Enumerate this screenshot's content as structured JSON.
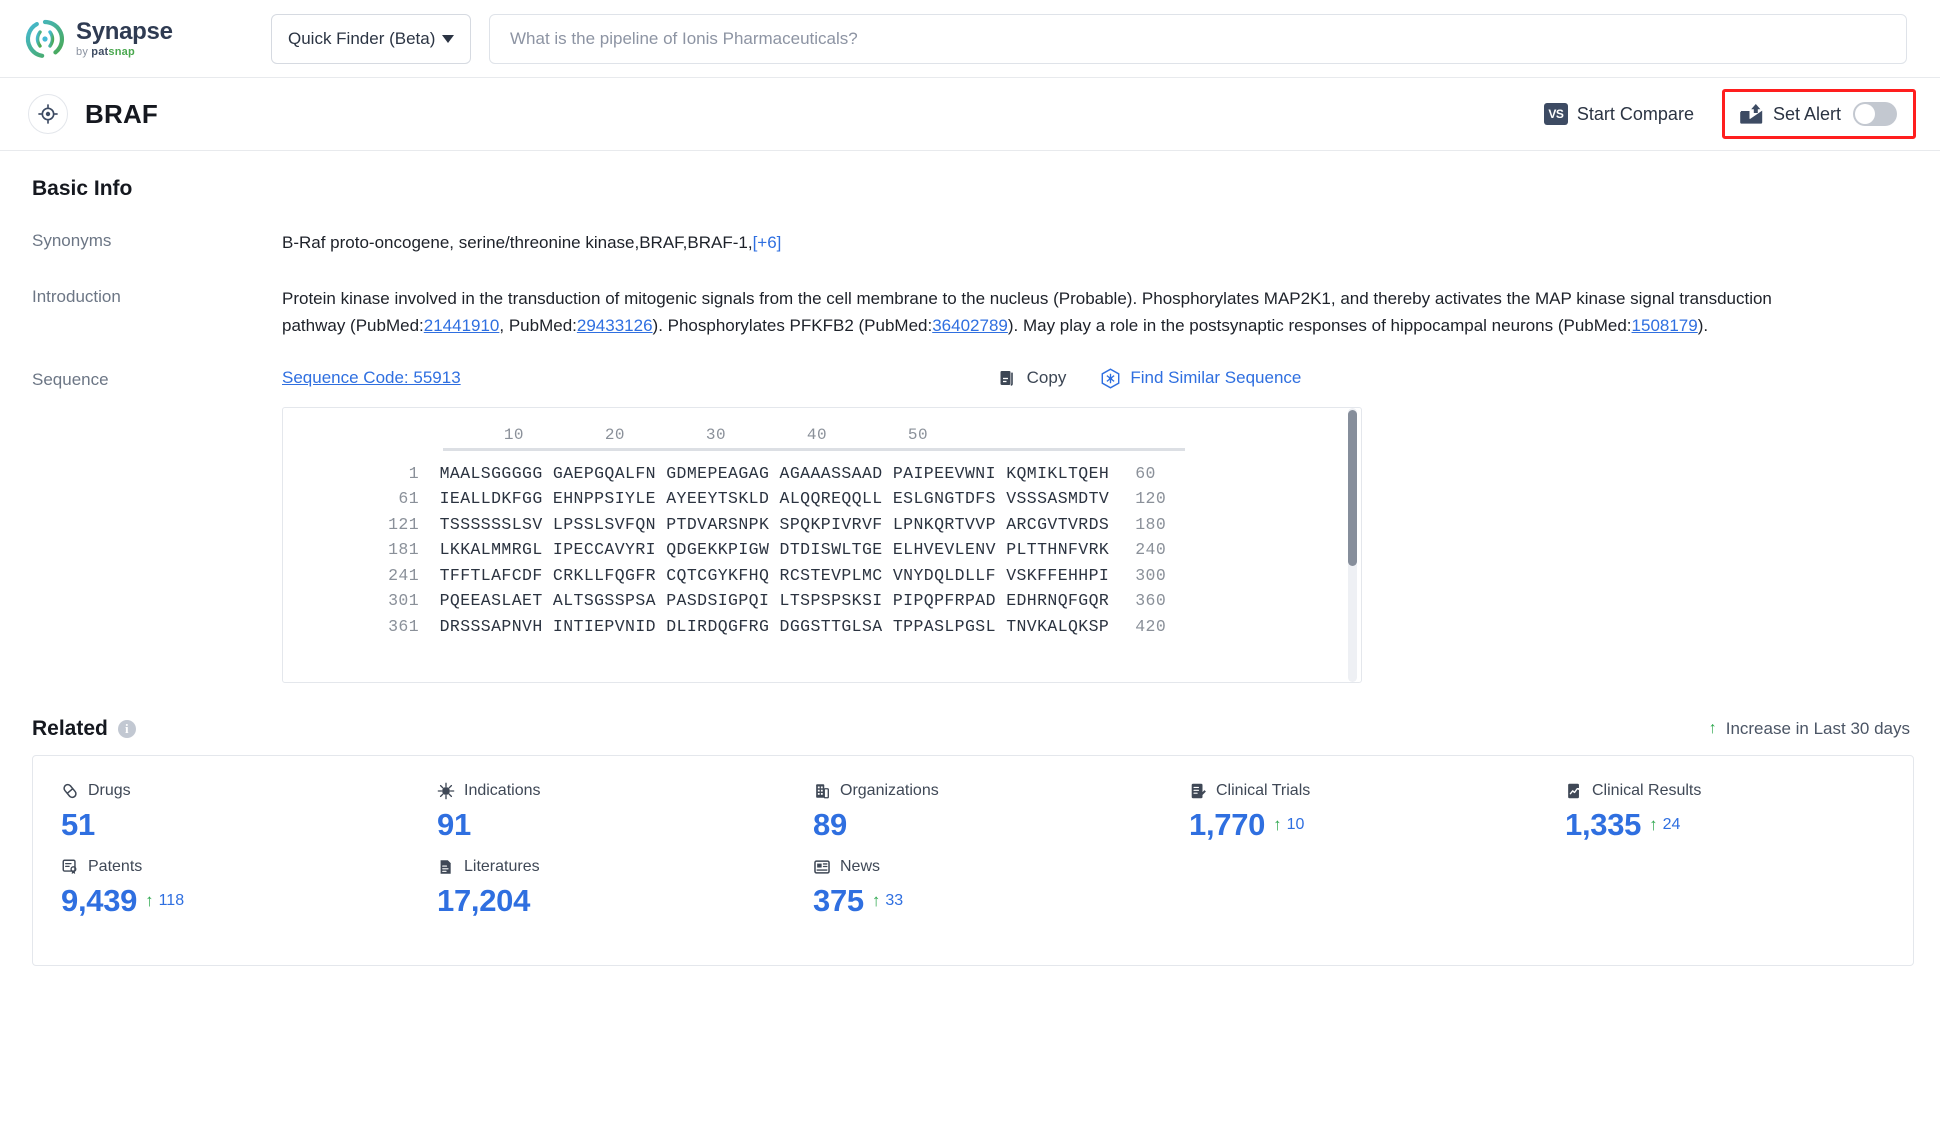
{
  "brand": {
    "logo_icon": "synapse-logo-icon",
    "name": "Synapse",
    "by": "by",
    "sub_pat": "pat",
    "sub_snap": "snap",
    "accent_teal": "#3fb6c8",
    "accent_green": "#4aa84f"
  },
  "header": {
    "finder_label": "Quick Finder (Beta)",
    "finder_caret_icon": "chevron-down-icon",
    "search_placeholder": "What is the pipeline of Ionis Pharmaceuticals?",
    "search_value": ""
  },
  "titlebar": {
    "target_icon": "target-icon",
    "title": "BRAF",
    "compare_icon": "vs-icon",
    "compare_icon_text": "VS",
    "compare_label": "Start Compare",
    "alert_icon": "alert-mail-icon",
    "alert_label": "Set Alert",
    "alert_toggle_state": "off",
    "highlight_color": "#ff1e1e"
  },
  "basic_info": {
    "heading": "Basic Info",
    "synonyms_label": "Synonyms",
    "synonyms_value": "B-Raf proto-oncogene, serine/threonine kinase,BRAF,BRAF-1,",
    "synonyms_more": "[+6]",
    "introduction_label": "Introduction",
    "introduction": {
      "p1": "Protein kinase involved in the transduction of mitogenic signals from the cell membrane to the nucleus (Probable). Phosphorylates MAP2K1, and thereby activates the MAP kinase signal transduction pathway (PubMed:",
      "link1": "21441910",
      "p2": ", PubMed:",
      "link2": "29433126",
      "p3": "). Phosphorylates PFKFB2 (PubMed:",
      "link3": "36402789",
      "p4": "). May play a role in the postsynaptic responses of hippocampal neurons (PubMed:",
      "link4": "1508179",
      "p5": ")."
    }
  },
  "sequence": {
    "label": "Sequence",
    "code_label": "Sequence Code: 55913",
    "copy_icon": "copy-icon",
    "copy_label": "Copy",
    "similar_icon": "find-similar-icon",
    "similar_label": "Find Similar Sequence",
    "ruler": "        10        20        30        40        50",
    "rows": [
      {
        "start": "1",
        "seq": "MAALSGGGGG GAEPGQALFN GDMEPEAGAG AGAAASSAAD PAIPEEVWNI KQMIKLTQEH",
        "end": "60"
      },
      {
        "start": "61",
        "seq": "IEALLDKFGG EHNPPSIYLE AYEEYTSKLD ALQQREQQLL ESLGNGTDFS VSSSASMDTV",
        "end": "120"
      },
      {
        "start": "121",
        "seq": "TSSSSSSLSV LPSSLSVFQN PTDVARSNPK SPQKPIVRVF LPNKQRTVVP ARCGVTVRDS",
        "end": "180"
      },
      {
        "start": "181",
        "seq": "LKKALMMRGL IPECCAVYRI QDGEKKPIGW DTDISWLTGE ELHVEVLENV PLTTHNFVRK",
        "end": "240"
      },
      {
        "start": "241",
        "seq": "TFFTLAFCDF CRKLLFQGFR CQTCGYKFHQ RCSTEVPLMC VNYDQLDLLF VSKFFEHHPI",
        "end": "300"
      },
      {
        "start": "301",
        "seq": "PQEEASLAET ALTSGSSPSA PASDSIGPQI LTSPSPSKSI PIPQPFRPAD EDHRNQFGQR",
        "end": "360"
      },
      {
        "start": "361",
        "seq": "DRSSSAPNVH INTIEPVNID DLIRDQGFRG DGGSTTGLSA TPPASLPGSL TNVKALQKSP",
        "end": "420"
      }
    ]
  },
  "related": {
    "heading": "Related",
    "info_icon": "info-icon",
    "info_glyph": "i",
    "increase_icon": "up-arrow-icon",
    "increase_label": "Increase in Last 30 days",
    "stats": [
      {
        "icon": "drugs-pill-icon",
        "label": "Drugs",
        "value": "51",
        "delta": ""
      },
      {
        "icon": "indications-virus-icon",
        "label": "Indications",
        "value": "91",
        "delta": ""
      },
      {
        "icon": "organizations-building-icon",
        "label": "Organizations",
        "value": "89",
        "delta": ""
      },
      {
        "icon": "clinical-trials-icon",
        "label": "Clinical Trials",
        "value": "1,770",
        "delta": "10"
      },
      {
        "icon": "clinical-results-icon",
        "label": "Clinical Results",
        "value": "1,335",
        "delta": "24"
      },
      {
        "icon": "patents-icon",
        "label": "Patents",
        "value": "9,439",
        "delta": "118"
      },
      {
        "icon": "literatures-icon",
        "label": "Literatures",
        "value": "17,204",
        "delta": ""
      },
      {
        "icon": "news-icon",
        "label": "News",
        "value": "375",
        "delta": "33"
      }
    ]
  }
}
